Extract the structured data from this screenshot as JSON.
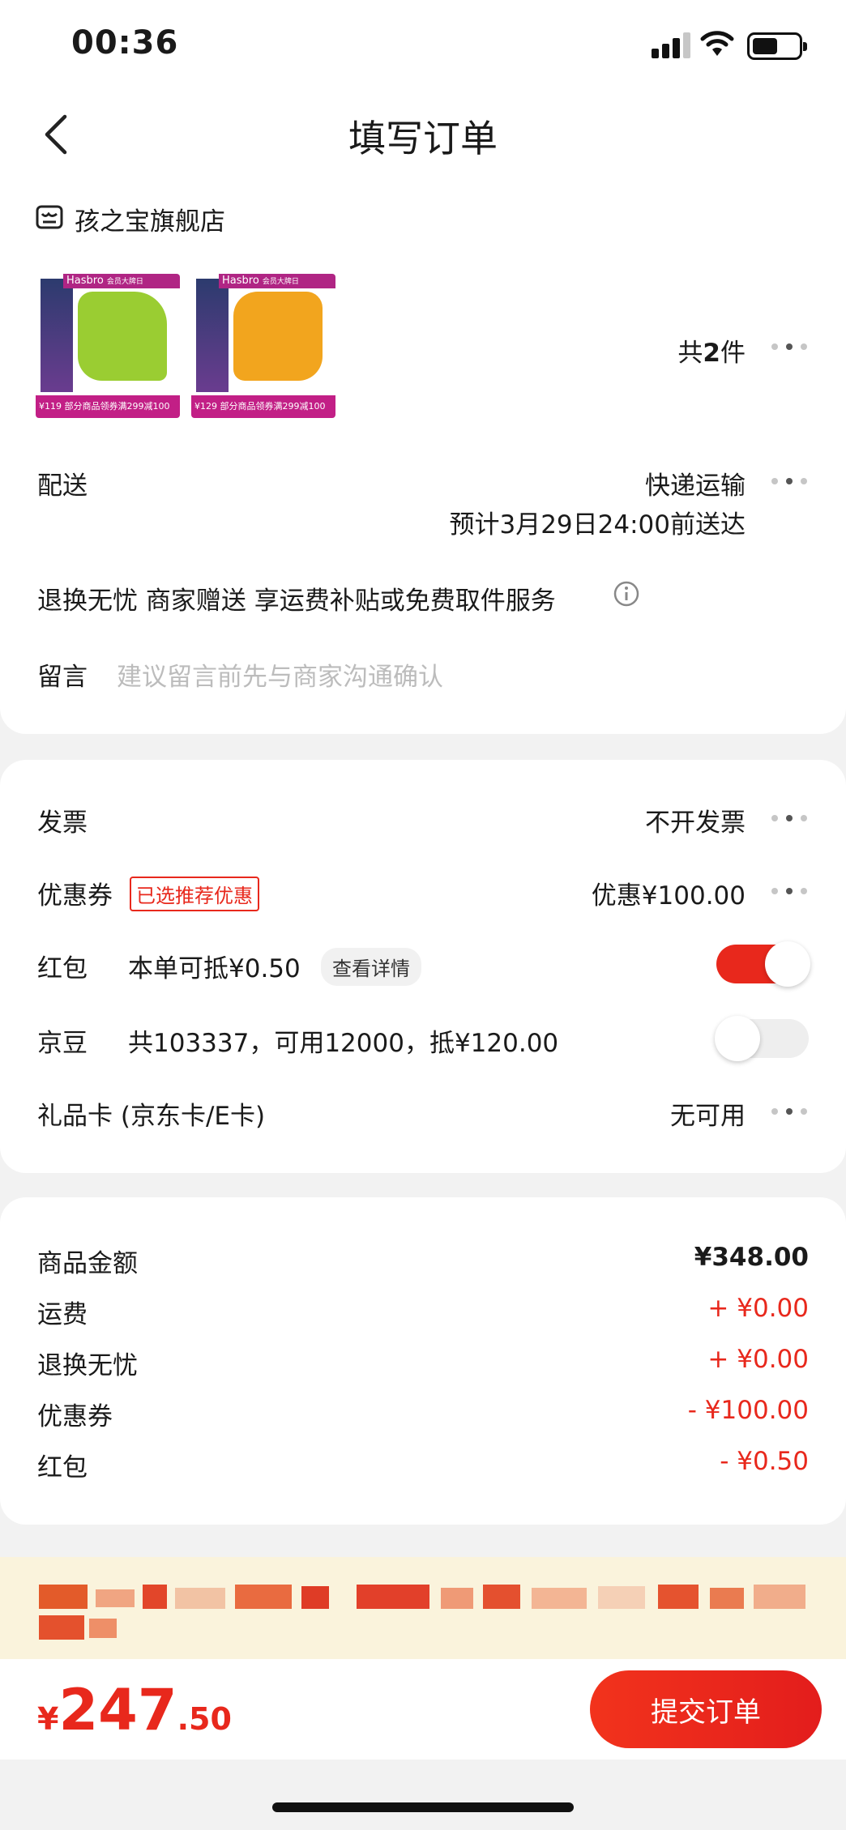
{
  "status_bar": {
    "time": "00:36",
    "signal": "signal-icon",
    "wifi": "wifi-icon",
    "battery": "battery-icon"
  },
  "header": {
    "title": "填写订单",
    "back_icon": "chevron-left-icon"
  },
  "shop": {
    "name": "孩之宝旗舰店",
    "icon": "shop-icon"
  },
  "products": {
    "count_label": "共",
    "count": "2",
    "count_unit": "件",
    "items": [
      {
        "brand": "Hasbro",
        "badge": "会员大牌日",
        "price": "¥119",
        "promo": "部分商品领券满299减100",
        "color": "#9acd32"
      },
      {
        "brand": "Hasbro",
        "badge": "会员大牌日",
        "price": "¥129",
        "promo": "部分商品领券满299减100",
        "color": "#f2a51e"
      }
    ]
  },
  "delivery": {
    "label": "配送",
    "method": "快递运输",
    "eta": "预计3月29日24:00前送达"
  },
  "service": {
    "text": "退换无忧 商家赠送 享运费补贴或免费取件服务",
    "info_icon": "info-icon"
  },
  "message": {
    "label": "留言",
    "placeholder": "建议留言前先与商家沟通确认"
  },
  "invoice": {
    "label": "发票",
    "value": "不开发票"
  },
  "coupon": {
    "label": "优惠券",
    "tag": "已选推荐优惠",
    "value": "优惠¥100.00"
  },
  "red_packet": {
    "label": "红包",
    "desc": "本单可抵¥0.50",
    "detail_button": "查看详情",
    "toggle_on": true,
    "toggle_color": "#e8281c"
  },
  "jingdou": {
    "label": "京豆",
    "desc": "共103337，可用12000，抵¥120.00",
    "toggle_on": false
  },
  "gift_card": {
    "label": "礼品卡 (京东卡/E卡)",
    "value": "无可用"
  },
  "summary": [
    {
      "label": "商品金额",
      "value": "¥348.00",
      "red": false
    },
    {
      "label": "运费",
      "value": "+ ¥0.00",
      "red": true
    },
    {
      "label": "退换无忧",
      "value": "+ ¥0.00",
      "red": true
    },
    {
      "label": "优惠券",
      "value": "- ¥100.00",
      "red": true
    },
    {
      "label": "红包",
      "value": "- ¥0.50",
      "red": true
    }
  ],
  "bottom": {
    "currency": "¥",
    "total_int": "247",
    "total_dec": ".50",
    "submit_label": "提交订单"
  },
  "colors": {
    "accent": "#e8281c",
    "notice_bg": "#faf3dc"
  }
}
